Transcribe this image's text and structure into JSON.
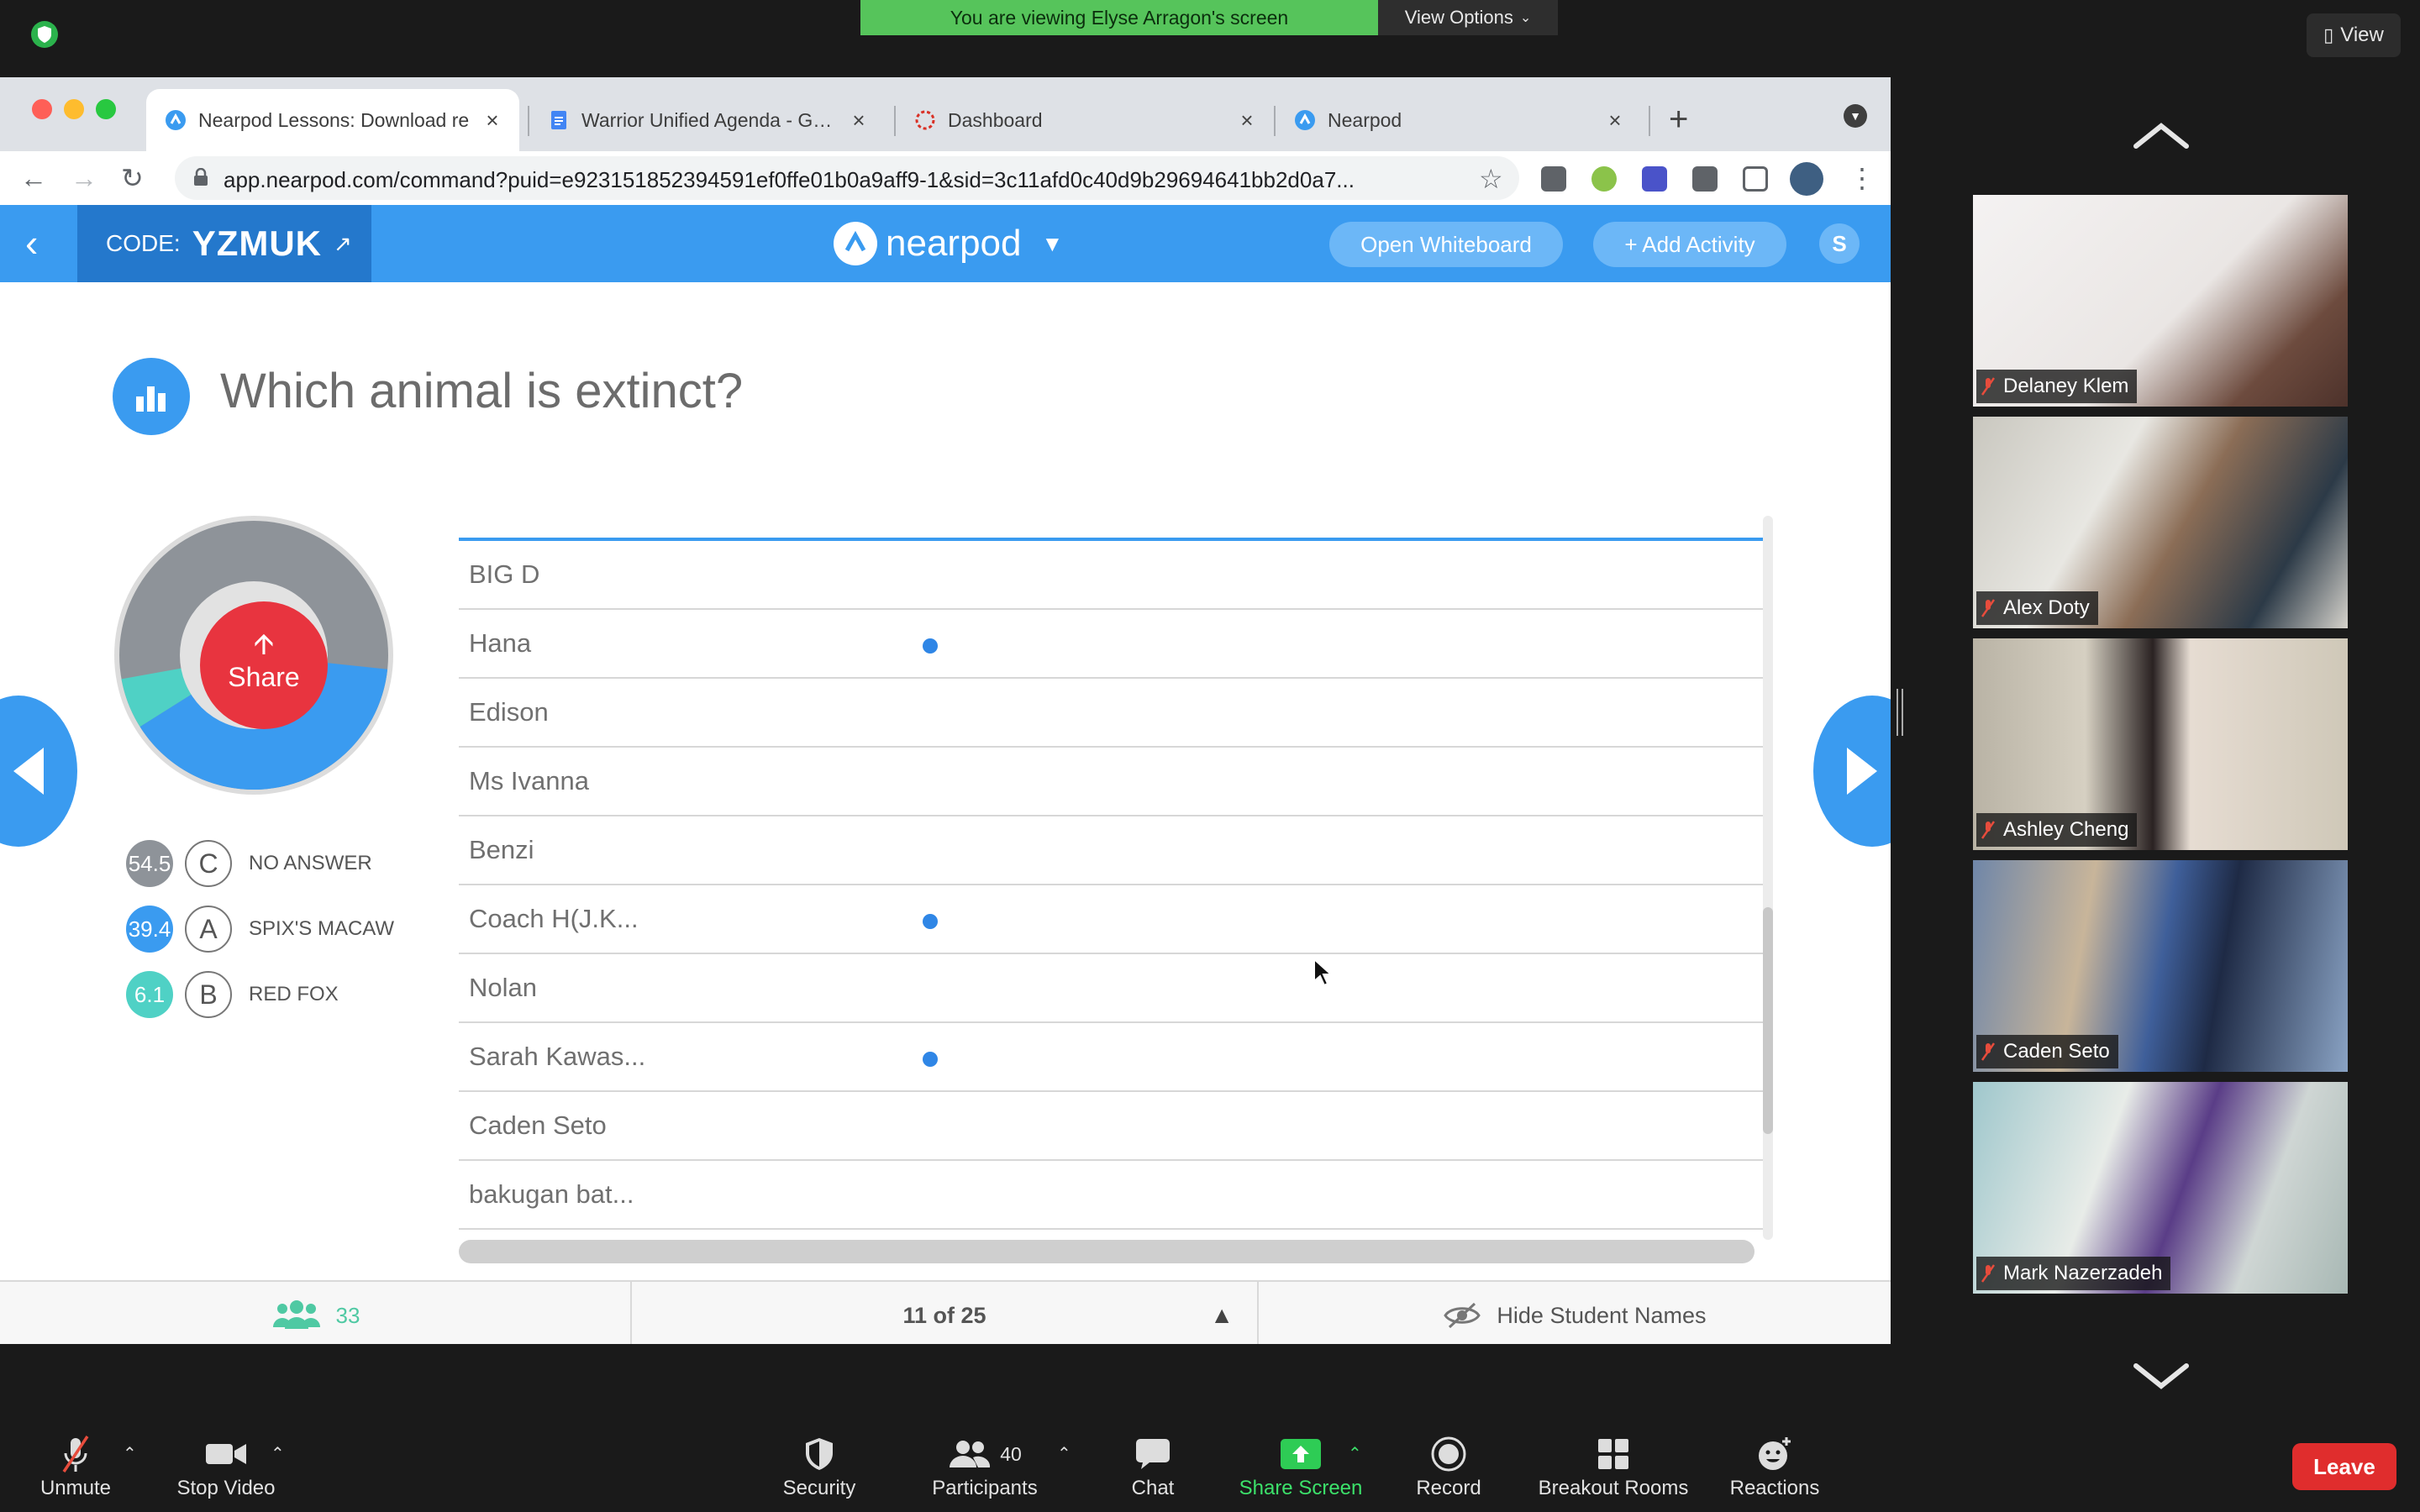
{
  "zoom": {
    "banner": "You are viewing Elyse Arragon's screen",
    "view_options": "View Options",
    "view": "View",
    "toolbar": {
      "unmute": "Unmute",
      "stop_video": "Stop Video",
      "security": "Security",
      "participants": "Participants",
      "participants_count": "40",
      "chat": "Chat",
      "share_screen": "Share Screen",
      "record": "Record",
      "breakout": "Breakout Rooms",
      "reactions": "Reactions",
      "leave": "Leave"
    },
    "videos": [
      {
        "name": "Delaney Klem"
      },
      {
        "name": "Alex Doty"
      },
      {
        "name": "Ashley Cheng"
      },
      {
        "name": "Caden Seto"
      },
      {
        "name": "Mark Nazerzadeh"
      }
    ]
  },
  "browser": {
    "tabs": [
      {
        "title": "Nearpod Lessons: Download re",
        "icon": "nearpod-icon",
        "active": true
      },
      {
        "title": "Warrior Unified Agenda - Goog",
        "icon": "google-docs-icon",
        "active": false
      },
      {
        "title": "Dashboard",
        "icon": "dashboard-icon",
        "active": false
      },
      {
        "title": "Nearpod",
        "icon": "nearpod-icon",
        "active": false
      }
    ],
    "url": "app.nearpod.com/command?puid=e923151852394591ef0ffe01b0a9aff9-1&sid=3c11afd0c40d9b29694641bb2d0a7..."
  },
  "nearpod": {
    "code_label": "CODE:",
    "code": "YZMUK",
    "logo": "nearpod",
    "open_whiteboard": "Open Whiteboard",
    "add_activity": "+ Add Activity",
    "avatar_letter": "S",
    "question": "Which animal is extinct?",
    "share": "Share",
    "results": [
      {
        "pct": "54.5",
        "letter": "C",
        "answer": "NO ANSWER",
        "color": "#8e9399"
      },
      {
        "pct": "39.4",
        "letter": "A",
        "answer": "SPIX'S MACAW",
        "color": "#3a9bf0"
      },
      {
        "pct": "6.1",
        "letter": "B",
        "answer": "RED FOX",
        "color": "#4fd1c5"
      }
    ],
    "students": [
      {
        "name": "BIG D",
        "answered": false
      },
      {
        "name": "Hana",
        "answered": true
      },
      {
        "name": "Edison",
        "answered": false
      },
      {
        "name": "Ms Ivanna",
        "answered": false
      },
      {
        "name": "Benzi",
        "answered": false
      },
      {
        "name": "Coach H(J.K...",
        "answered": true
      },
      {
        "name": "Nolan",
        "answered": false
      },
      {
        "name": "Sarah Kawas...",
        "answered": true
      },
      {
        "name": "Caden Seto",
        "answered": false
      },
      {
        "name": "bakugan bat...",
        "answered": false
      }
    ],
    "footer": {
      "student_count": "33",
      "page": "11 of 25",
      "hide_names": "Hide Student Names"
    }
  }
}
